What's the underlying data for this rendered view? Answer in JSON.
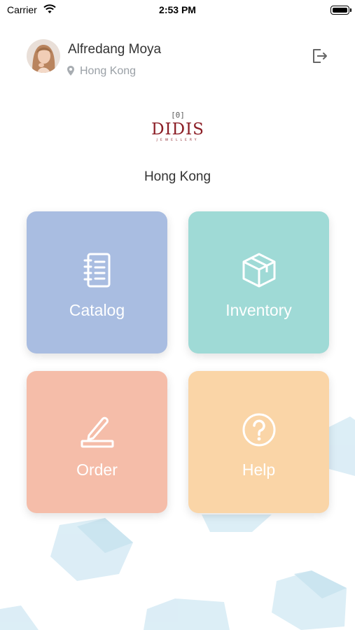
{
  "status_bar": {
    "carrier": "Carrier",
    "time": "2:53 PM"
  },
  "user": {
    "name": "Alfredang Moya",
    "location": "Hong Kong"
  },
  "logo": {
    "mark": "[0]",
    "name": "DIDIS",
    "sub": "JEWELLERY"
  },
  "store": {
    "location": "Hong Kong"
  },
  "tiles": [
    {
      "label": "Catalog",
      "icon": "notebook-icon",
      "color": "#a9bde1"
    },
    {
      "label": "Inventory",
      "icon": "box-icon",
      "color": "#9fdad6"
    },
    {
      "label": "Order",
      "icon": "pen-icon",
      "color": "#f5bda9"
    },
    {
      "label": "Help",
      "icon": "question-circle-icon",
      "color": "#fad5a7"
    }
  ]
}
